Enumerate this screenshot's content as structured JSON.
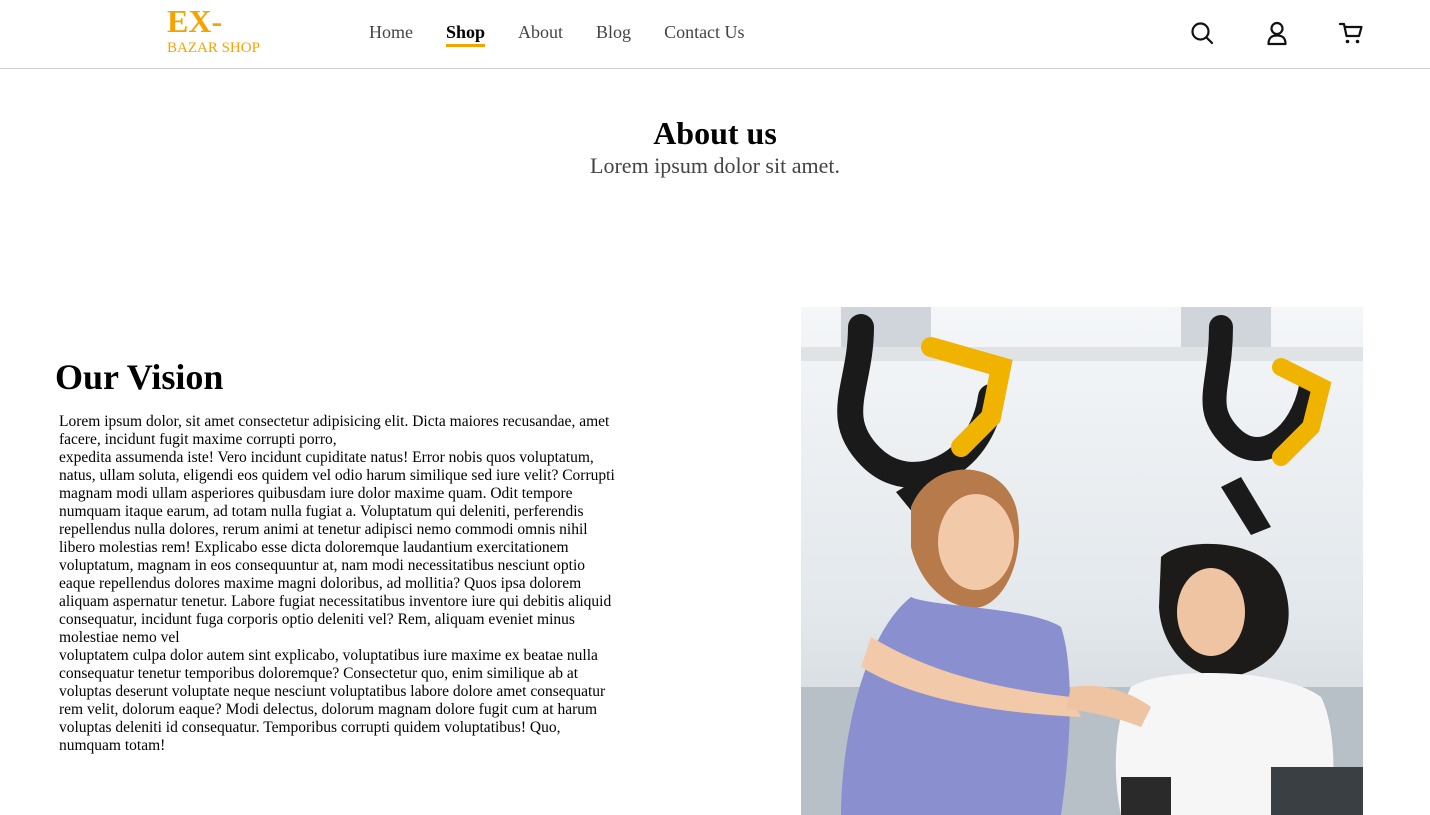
{
  "header": {
    "logo": {
      "main": "EX-",
      "sub": "BAZAR SHOP"
    },
    "nav": [
      {
        "label": "Home"
      },
      {
        "label": "Shop"
      },
      {
        "label": "About"
      },
      {
        "label": "Blog"
      },
      {
        "label": "Contact Us"
      }
    ],
    "active_nav": "Shop",
    "icons": [
      "search-icon",
      "user-icon",
      "cart-icon"
    ]
  },
  "hero": {
    "title": "About us",
    "subtitle": "Lorem ipsum dolor sit amet."
  },
  "vision": {
    "heading": "Our Vision",
    "paragraphs": [
      "Lorem ipsum dolor, sit amet consectetur adipisicing elit. Dicta maiores recusandae, amet facere, incidunt fugit maxime corrupti porro,",
      "expedita assumenda iste! Vero incidunt cupiditate natus! Error nobis quos voluptatum, natus, ullam soluta, eligendi eos quidem vel odio harum similique sed iure velit? Corrupti magnam modi ullam asperiores quibusdam iure dolor maxime quam. Odit tempore numquam itaque earum, ad totam nulla fugiat a. Voluptatum qui deleniti, perferendis",
      "repellendus nulla dolores, rerum animi at tenetur adipisci nemo commodi omnis nihil libero molestias rem! Explicabo esse dicta doloremque laudantium exercitationem voluptatum, magnam in eos consequuntur at, nam modi necessitatibus nesciunt optio eaque repellendus dolores maxime magni doloribus, ad mollitia? Quos ipsa dolorem aliquam aspernatur tenetur. Labore fugiat necessitatibus inventore iure qui debitis aliquid consequatur, incidunt fuga corporis optio deleniti vel? Rem, aliquam eveniet minus molestiae nemo vel",
      "voluptatem culpa dolor autem sint explicabo, voluptatibus iure maxime ex beatae nulla consequatur tenetur temporibus doloremque? Consectetur quo, enim similique ab at voluptas deserunt voluptate neque nesciunt voluptatibus labore dolore amet consequatur rem velit, dolorum eaque? Modi delectus, dolorum magnam dolore fugit cum at harum voluptas deleniti id consequatur. Temporibus corrupti quidem voluptatibus! Quo, numquam totam!"
    ]
  },
  "colors": {
    "accent": "#f5a300",
    "nav_text": "#444444",
    "border": "#cfcfcf"
  }
}
